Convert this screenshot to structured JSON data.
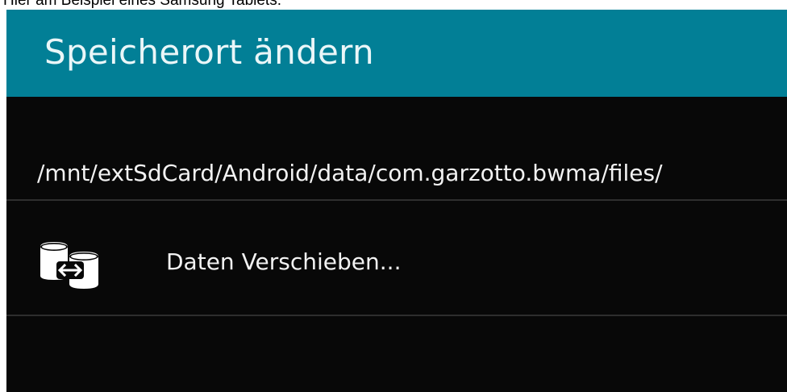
{
  "caption": "Hier am Beispiel eines Samsung Tablets:",
  "dialog": {
    "title": "Speicherort ändern",
    "path": "/mnt/extSdCard/Android/data/com.garzotto.bwma/files/",
    "move_action": {
      "label": "Daten Verschieben...",
      "icon": "move-data-icon"
    }
  },
  "colors": {
    "action_bar": "#027f96",
    "background": "#080808",
    "text": "#f2f2f2",
    "divider": "#2e2e2e"
  }
}
